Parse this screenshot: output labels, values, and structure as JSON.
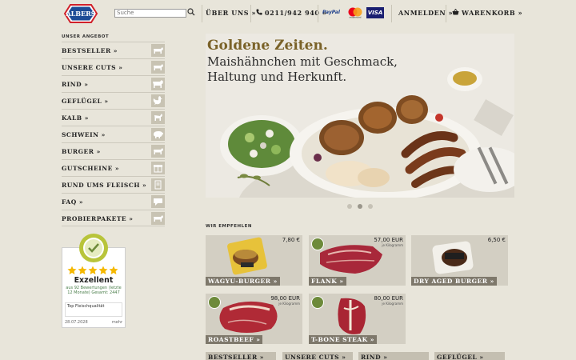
{
  "header": {
    "logo_text": "ALBERS",
    "search_placeholder": "Suche",
    "about_label": "ÜBER UNS »",
    "phone_label": "0211/942 940 »",
    "login_label": "ANMELDEN »",
    "cart_label": "WARENKORB »",
    "payment": [
      "PayPal",
      "mastercard",
      "VISA"
    ]
  },
  "sidebar": {
    "title": "UNSER ANGEBOT",
    "items": [
      {
        "label": "BESTSELLER »",
        "icon": "cow-icon"
      },
      {
        "label": "UNSERE CUTS »",
        "icon": "cow-icon"
      },
      {
        "label": "RIND »",
        "icon": "cow-icon"
      },
      {
        "label": "GEFLÜGEL »",
        "icon": "chicken-icon"
      },
      {
        "label": "KALB »",
        "icon": "calf-icon"
      },
      {
        "label": "SCHWEIN »",
        "icon": "pig-icon"
      },
      {
        "label": "BURGER »",
        "icon": "cow-icon"
      },
      {
        "label": "GUTSCHEINE »",
        "icon": "gift-icon"
      },
      {
        "label": "RUND UMS FLEISCH »",
        "icon": "book-icon"
      },
      {
        "label": "FAQ »",
        "icon": "chat-icon"
      },
      {
        "label": "PROBIERPAKETE »",
        "icon": "cow-icon"
      }
    ]
  },
  "trust": {
    "title": "Exzellent",
    "rating_stars": 5,
    "subtitle": "aus 92 Bewertungen (letzte 12 Monate) Gesamt: 2447",
    "quote": "Top Fleischqualität",
    "date": "28.07.2028",
    "more": "mehr"
  },
  "hero": {
    "headline": "Goldene Zeiten.",
    "subline1": "Maishähnchen mit Geschmack,",
    "subline2": "Haltung und Herkunft.",
    "slide_count": 3,
    "active_slide": 1
  },
  "recommendations": {
    "title": "WIR EMPFEHLEN",
    "items": [
      {
        "name": "WAGYU-BURGER »",
        "price": "7,80 €",
        "unit": ""
      },
      {
        "name": "FLANK »",
        "price": "57,00 EUR",
        "unit": "je Kilogramm"
      },
      {
        "name": "DRY AGED BURGER »",
        "price": "6,50 €",
        "unit": ""
      },
      {
        "name": "ROASTBEEF »",
        "price": "98,00 EUR",
        "unit": "je Kilogramm"
      },
      {
        "name": "T-BONE STEAK »",
        "price": "80,00 EUR",
        "unit": "je Kilogramm"
      }
    ]
  },
  "bottom_tiles": [
    "BESTSELLER »",
    "UNSERE CUTS »",
    "RIND »",
    "GEFLÜGEL »"
  ],
  "colors": {
    "background": "#e8e5da",
    "logo_blue": "#1d4c96",
    "logo_red": "#d0202a",
    "headline_gold": "#7a6228"
  }
}
